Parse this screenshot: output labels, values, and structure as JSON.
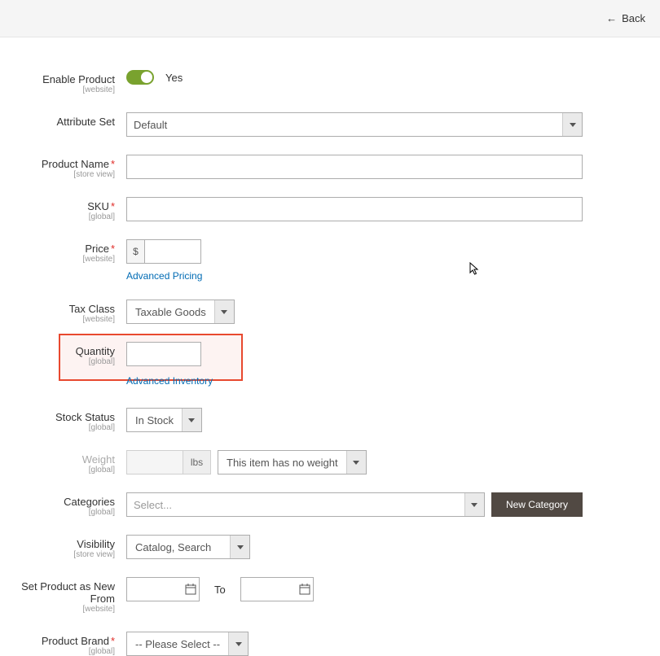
{
  "topbar": {
    "back": "Back"
  },
  "form": {
    "enable": {
      "label": "Enable Product",
      "scope": "[website]",
      "value": "Yes"
    },
    "attrset": {
      "label": "Attribute Set",
      "value": "Default"
    },
    "name": {
      "label": "Product Name",
      "scope": "[store view]",
      "value": ""
    },
    "sku": {
      "label": "SKU",
      "scope": "[global]",
      "value": ""
    },
    "price": {
      "label": "Price",
      "scope": "[website]",
      "currency": "$",
      "value": "",
      "link": "Advanced Pricing"
    },
    "tax": {
      "label": "Tax Class",
      "scope": "[website]",
      "value": "Taxable Goods"
    },
    "qty": {
      "label": "Quantity",
      "scope": "[global]",
      "value": "",
      "link": "Advanced Inventory"
    },
    "stock": {
      "label": "Stock Status",
      "scope": "[global]",
      "value": "In Stock"
    },
    "weight": {
      "label": "Weight",
      "scope": "[global]",
      "unit": "lbs",
      "noweight": "This item has no weight"
    },
    "categories": {
      "label": "Categories",
      "scope": "[global]",
      "placeholder": "Select...",
      "new_btn": "New Category"
    },
    "visibility": {
      "label": "Visibility",
      "scope": "[store view]",
      "value": "Catalog, Search"
    },
    "newfrom": {
      "label": "Set Product as New From",
      "scope": "[website]",
      "to": "To"
    },
    "brand": {
      "label": "Product Brand",
      "scope": "[global]",
      "value": "-- Please Select --"
    }
  }
}
